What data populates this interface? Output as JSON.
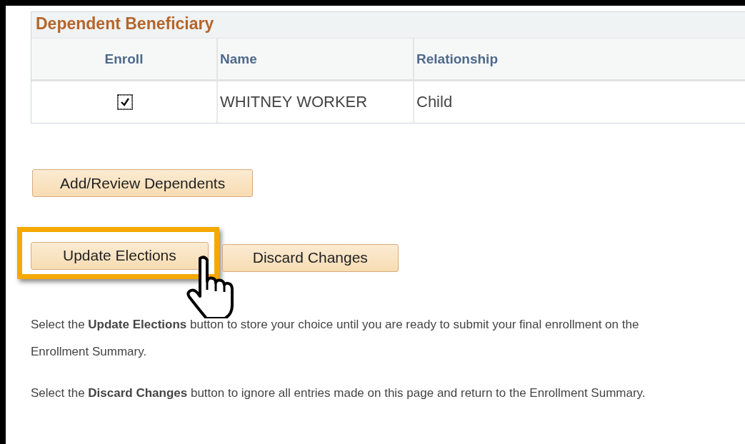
{
  "section": {
    "title": "Dependent Beneficiary",
    "columns": [
      "Enroll",
      "Name",
      "Relationship"
    ],
    "rows": [
      {
        "enroll": true,
        "name": "WHITNEY WORKER",
        "relationship": "Child"
      }
    ]
  },
  "add_button": {
    "label": "Add/Review Dependents"
  },
  "buttons": [
    {
      "label": "Update Elections",
      "highlighted": true
    },
    {
      "label": "Discard Changes",
      "highlighted": false
    }
  ],
  "notes": [
    "Select the **Update Elections** button to store your choice until you are ready to submit your final enrollment on the Enrollment Summary.",
    "Select the **Discard Changes** button to ignore all entries made on this page and return to the Enrollment Summary."
  ]
}
